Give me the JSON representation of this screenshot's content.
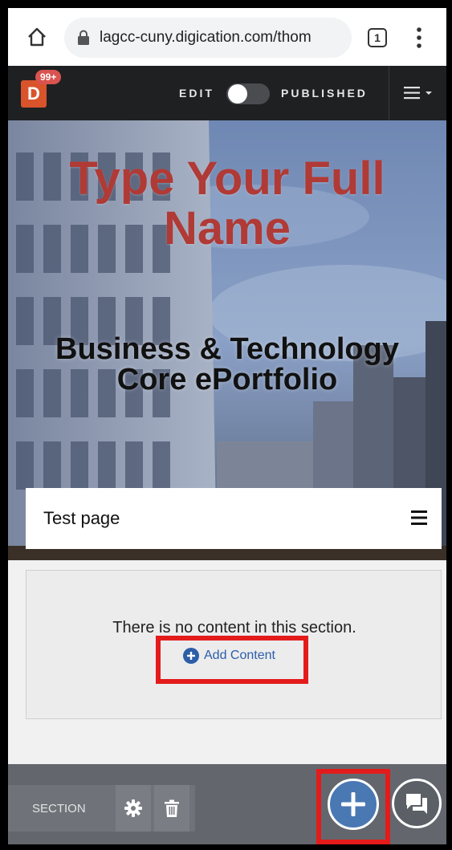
{
  "browser": {
    "url": "lagcc-cuny.digication.com/thom",
    "tab_count": "1"
  },
  "app_bar": {
    "logo_letter": "D",
    "notification_count": "99+",
    "edit_label": "EDIT",
    "published_label": "PUBLISHED",
    "toggle_state": "off"
  },
  "hero": {
    "name": "Type Your Full Name",
    "subtitle": "Business & Technology Core ePortfolio"
  },
  "page": {
    "title": "Test page"
  },
  "section": {
    "empty_message": "There is no content in this section.",
    "add_content_label": "Add Content"
  },
  "toolbar": {
    "section_label": "SECTION"
  },
  "colors": {
    "app_bar": "#1f2022",
    "hero_name": "#b03a36",
    "accent_blue": "#4a78b3",
    "highlight_red": "#e41b1b",
    "toolbar": "#63676d"
  },
  "icons": [
    "home-icon",
    "lock-icon",
    "tabs-icon",
    "menu-dots-icon",
    "hamburger-menu-icon",
    "page-menu-icon",
    "plus-circle-icon",
    "gear-icon",
    "trash-icon",
    "add-fab-icon",
    "chat-icon"
  ]
}
